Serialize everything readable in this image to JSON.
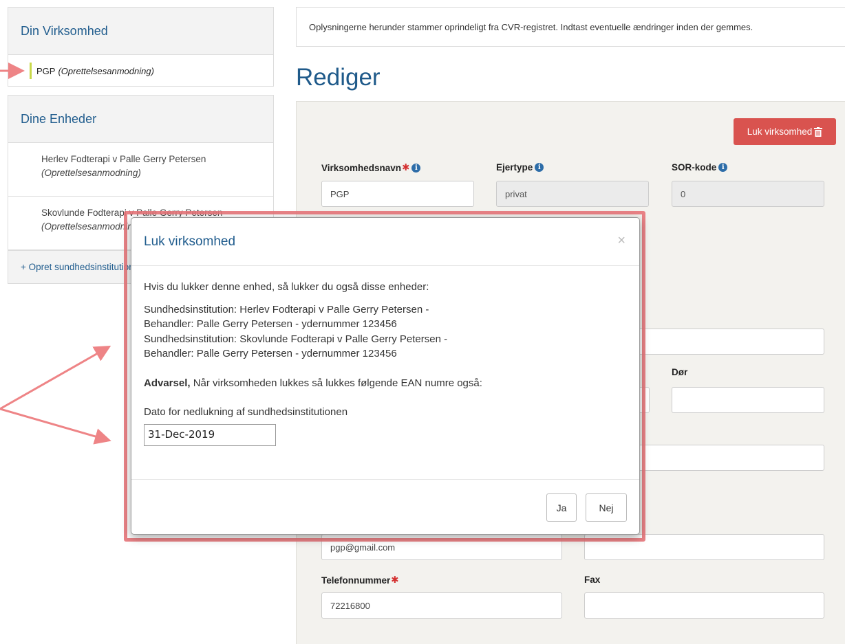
{
  "sidebar": {
    "company_title": "Din Virksomhed",
    "company_item": {
      "name": "PGP",
      "status": "(Oprettelsesanmodning)"
    },
    "units_title": "Dine Enheder",
    "units": [
      {
        "name": "Herlev Fodterapi v Palle Gerry Petersen",
        "status": "(Oprettelsesanmodning)"
      },
      {
        "name": "Skovlunde Fodterapi v Palle Gerry Petersen",
        "status": "(Oprettelsesanmodning)"
      }
    ],
    "add_label": "+ Opret sundhedsinstitution"
  },
  "main": {
    "notice": "Oplysningerne herunder stammer oprindeligt fra CVR-registret. Indtast eventuelle ændringer inden der gemmes.",
    "title": "Rediger",
    "close_company_label": "Luk virksomhed",
    "fields": {
      "company_name_label": "Virksomhedsnavn",
      "company_name_value": "PGP",
      "owner_type_label": "Ejertype",
      "owner_type_value": "privat",
      "sor_label": "SOR-kode",
      "sor_value": "0",
      "door_label": "Dør",
      "email_value": "pgp@gmail.com",
      "phone_label": "Telefonnummer",
      "phone_value": "72216800",
      "fax_label": "Fax"
    }
  },
  "modal": {
    "title": "Luk virksomhed",
    "close_glyph": "×",
    "intro": "Hvis du lukker denne enhed, så lukker du også disse enheder:",
    "lines": [
      "Sundhedsinstitution: Herlev Fodterapi v Palle Gerry Petersen -",
      "Behandler: Palle Gerry Petersen - ydernummer 123456",
      "Sundhedsinstitution: Skovlunde Fodterapi v Palle Gerry Petersen -",
      "Behandler: Palle Gerry Petersen - ydernummer 123456"
    ],
    "warning_bold": "Advarsel,",
    "warning_text": " Når virksomheden lukkes så lukkes følgende EAN numre også:",
    "date_label": "Dato for nedlukning af sundhedsinstitutionen",
    "date_value": "31-Dec-2019",
    "yes_label": "Ja",
    "no_label": "Nej"
  },
  "colors": {
    "accent_blue": "#215d8e",
    "danger": "#d9534f",
    "annotation": "#e8757a",
    "status_bar": "#c8d84a"
  }
}
